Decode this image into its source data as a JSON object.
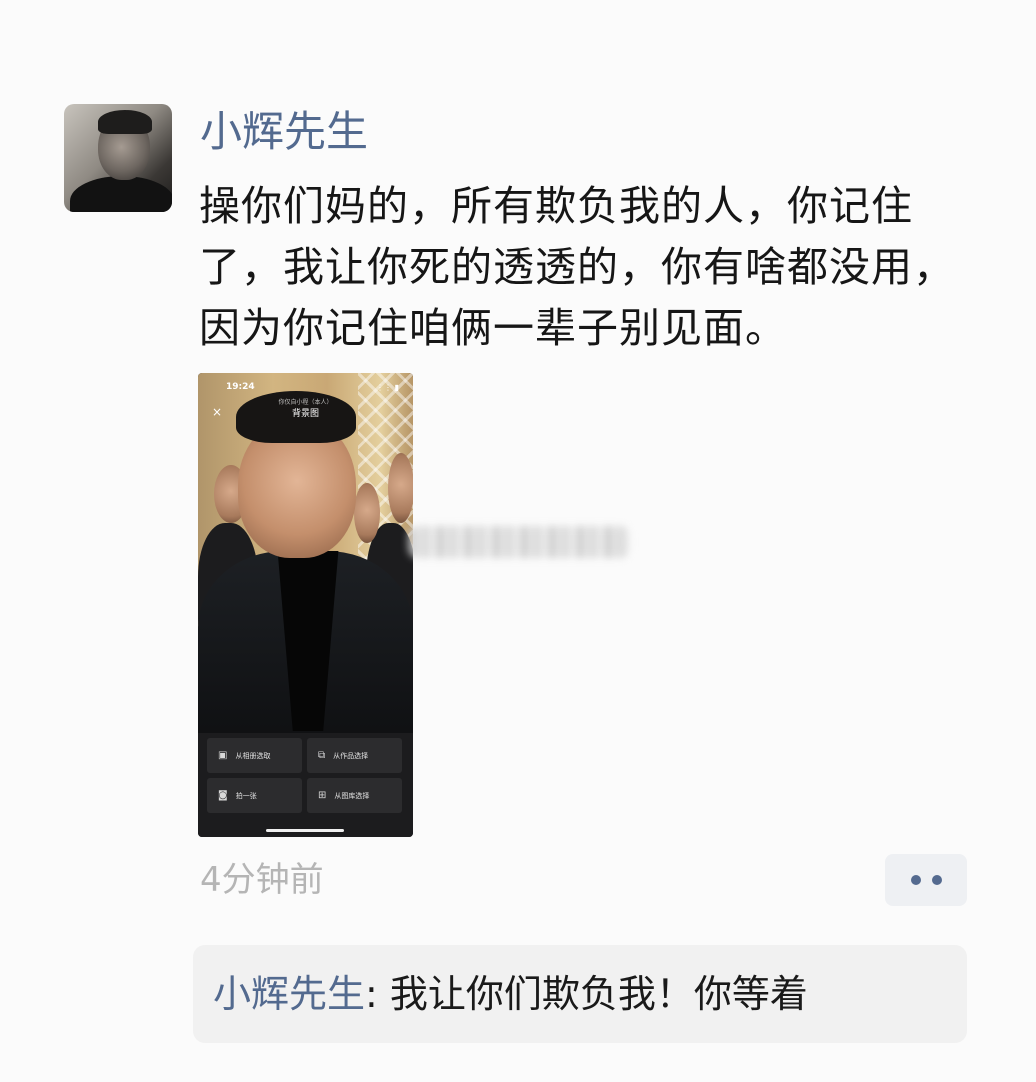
{
  "post": {
    "author": "小辉先生",
    "text": "操你们妈的，所有欺负我的人，你记住了，我让你死的透透的，你有啥都没用，因为你记住咱俩一辈子别见面。",
    "time": "4分钟前"
  },
  "screenshot": {
    "status_time": "19:24",
    "status_icons": "⋮⋮ ▮",
    "subtitle": "你仅自小程（本人）",
    "title": "背景图",
    "close_icon": "×",
    "options": [
      {
        "label": "从相册选取",
        "icon": "image-icon"
      },
      {
        "label": "从作品选择",
        "icon": "video-icon"
      },
      {
        "label": "拍一张",
        "icon": "camera-icon"
      },
      {
        "label": "从图库选择",
        "icon": "grid-icon"
      }
    ]
  },
  "comments": [
    {
      "author": "小辉先生",
      "separator": ":",
      "text": " 我让你们欺负我！你等着"
    }
  ],
  "colors": {
    "nickname": "#536a8f",
    "text": "#161616",
    "timestamp": "#b5b5b5",
    "comment_bg": "#f1f1f1"
  }
}
